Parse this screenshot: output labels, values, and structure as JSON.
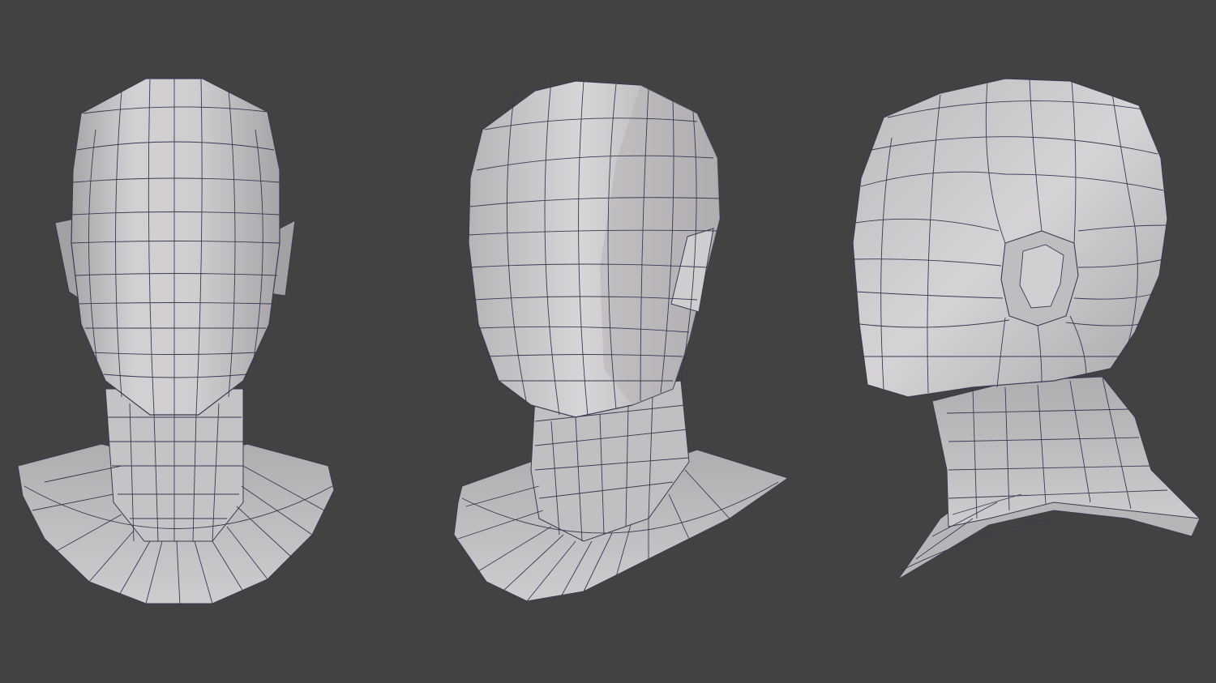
{
  "scene": {
    "background_color": "#424242",
    "mesh_fill_color": "#c9c6c9",
    "mesh_shadow_color": "#a9a6aa",
    "mesh_highlight_color": "#dedbde",
    "wireframe_color": "#3a3a52",
    "views": [
      {
        "name": "front-view"
      },
      {
        "name": "three-quarter-view"
      },
      {
        "name": "back-three-quarter-view"
      }
    ]
  }
}
